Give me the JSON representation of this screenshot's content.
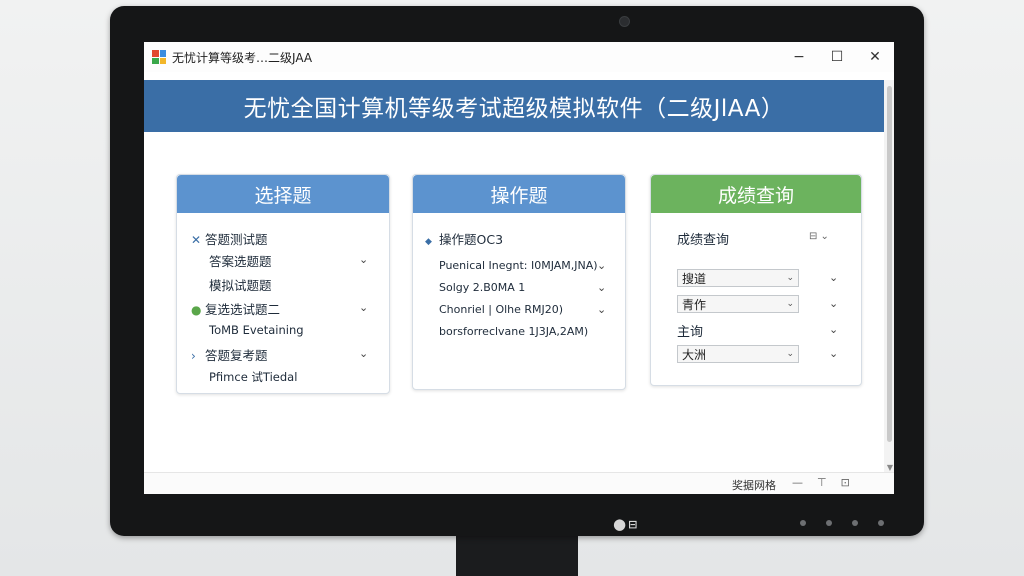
{
  "window": {
    "title": "无忧计算等级考…二级JAA",
    "minimize": "−",
    "maximize": "☐",
    "close": "✕"
  },
  "banner": {
    "title": "无忧全国计算机等级考试超级模拟软件（二级JlAA）"
  },
  "panels": {
    "choice": {
      "title": "选择题",
      "items": [
        {
          "marker": "✕",
          "label": "答题测试题"
        },
        {
          "marker": "",
          "label": "答案选题题"
        },
        {
          "marker": "",
          "label": "模拟试题题"
        },
        {
          "marker": "●",
          "label": "复选选试题二"
        },
        {
          "marker": "",
          "label": "ToMB Evetaining"
        },
        {
          "marker": "›",
          "label": "答题复考题"
        },
        {
          "marker": "",
          "label": "Pfimce 试Tiedal"
        }
      ]
    },
    "operation": {
      "title": "操作题",
      "items": [
        {
          "marker": "◆",
          "label": "操作题OC3"
        },
        {
          "marker": "",
          "label": "Puenical Inegnt: I0MJAM,JNA)"
        },
        {
          "marker": "",
          "label": "Solgy 2.B0MA 1"
        },
        {
          "marker": "",
          "label": "Chonriel | Olhe RMJ20)"
        },
        {
          "marker": "",
          "label": "borsforreclvane 1J3JA,2AM)"
        }
      ]
    },
    "score": {
      "title": "成绩查询",
      "header_label": "成绩查询",
      "selects": [
        {
          "value": "搜道"
        },
        {
          "value": "青作"
        },
        {
          "value": "主询"
        },
        {
          "value": "大洲"
        }
      ]
    }
  },
  "statusbar": {
    "text": "奖据网格"
  },
  "colors": {
    "banner": "#3a6ea6",
    "panel_blue": "#5c93cf",
    "panel_green": "#6cb35e",
    "bezel": "#151617"
  },
  "icons": {
    "app": "app-grid-icon",
    "chevron": "chevron-down-icon",
    "collapse": "collapse-icon"
  }
}
